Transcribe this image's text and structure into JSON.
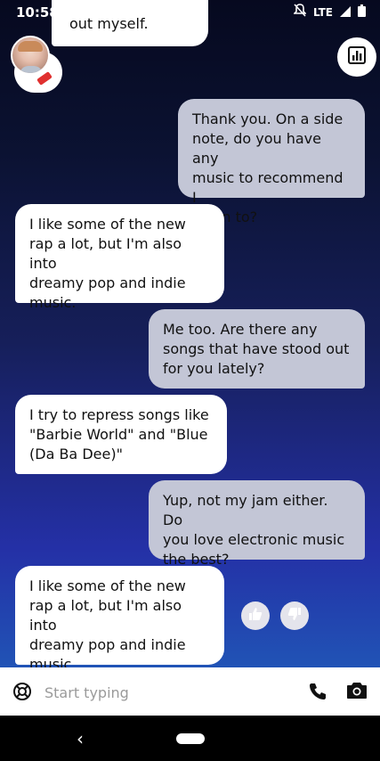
{
  "status_bar": {
    "time": "10:58",
    "network": "LTE",
    "icons": [
      "pinwheel-icon",
      "twitter-icon",
      "app-icon",
      "app-icon",
      "dot-icon",
      "mute-icon",
      "signal-icon",
      "battery-icon"
    ]
  },
  "messages": [
    {
      "sender": "bot",
      "text": "out myself."
    },
    {
      "sender": "user",
      "text": "Thank you. On a side\nnote, do you have any\nmusic to recommend I\nlisten to?"
    },
    {
      "sender": "bot",
      "text": "I like some of the new\nrap a lot, but I'm also into\ndreamy pop and indie\nmusic."
    },
    {
      "sender": "user",
      "text": "Me too. Are there any\nsongs that have stood out\nfor you lately?"
    },
    {
      "sender": "bot",
      "text": "I try to repress songs like\n\"Barbie World\" and \"Blue\n(Da Ba Dee)\""
    },
    {
      "sender": "user",
      "text": "Yup, not my jam either. Do\nyou love electronic music\nthe best?"
    },
    {
      "sender": "bot",
      "text": "I like some of the new\nrap a lot, but I'm also into\ndreamy pop and indie\nmusic."
    }
  ],
  "composer": {
    "placeholder": "Start typing"
  },
  "colors": {
    "user_bubble": "#c3c6d6",
    "bot_bubble": "#ffffff",
    "background_top": "#06091f",
    "background_bottom": "#1e6fc2"
  }
}
